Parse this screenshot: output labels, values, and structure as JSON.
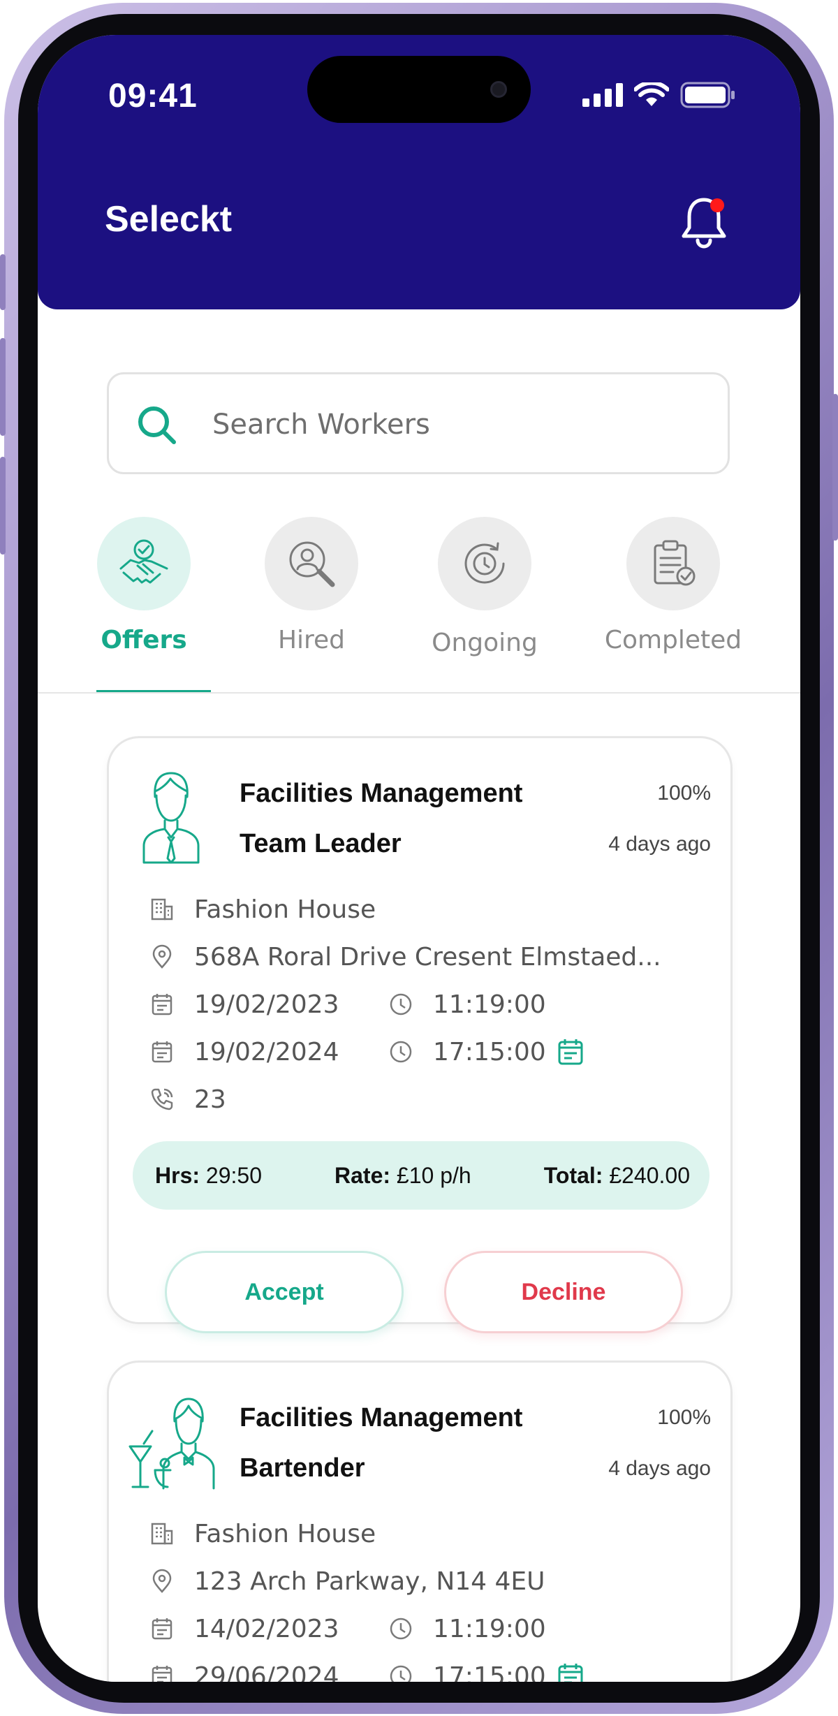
{
  "status_bar": {
    "time": "09:41"
  },
  "header": {
    "title": "Seleckt",
    "has_notification": true
  },
  "search": {
    "placeholder": "Search Workers",
    "value": ""
  },
  "tabs": [
    {
      "label": "Offers",
      "icon": "handshake-icon",
      "active": true
    },
    {
      "label": "Hired",
      "icon": "person-search-icon",
      "active": false
    },
    {
      "label": "Ongoing",
      "icon": "clock-cycle-icon",
      "active": false
    },
    {
      "label": "Completed",
      "icon": "clipboard-check-icon",
      "active": false
    }
  ],
  "offers": [
    {
      "company": "Facilities Management",
      "role": "Team Leader",
      "match": "100%",
      "posted": "4 days ago",
      "venue": "Fashion House",
      "address": "568A Roral Drive Cresent Elmstaed...",
      "start_date": "19/02/2023",
      "start_time": "11:19:00",
      "end_date": "19/02/2024",
      "end_time": "17:15:00",
      "phone": "23",
      "hrs_label": "Hrs:",
      "hrs": "29:50",
      "rate_label": "Rate:",
      "rate": "£10 p/h",
      "total_label": "Total:",
      "total": "£240.00",
      "accept_label": "Accept",
      "decline_label": "Decline"
    },
    {
      "company": "Facilities Management",
      "role": "Bartender",
      "match": "100%",
      "posted": "4 days ago",
      "venue": "Fashion House",
      "address": "123 Arch Parkway, N14 4EU",
      "start_date": "14/02/2023",
      "start_time": "11:19:00",
      "end_date": "29/06/2024",
      "end_time": "17:15:00"
    }
  ],
  "colors": {
    "header": "#1c1081",
    "accent": "#16a88a",
    "decline": "#e0394b",
    "summary_bg": "#ddf4ee",
    "notification_dot": "#ff1a1a"
  }
}
